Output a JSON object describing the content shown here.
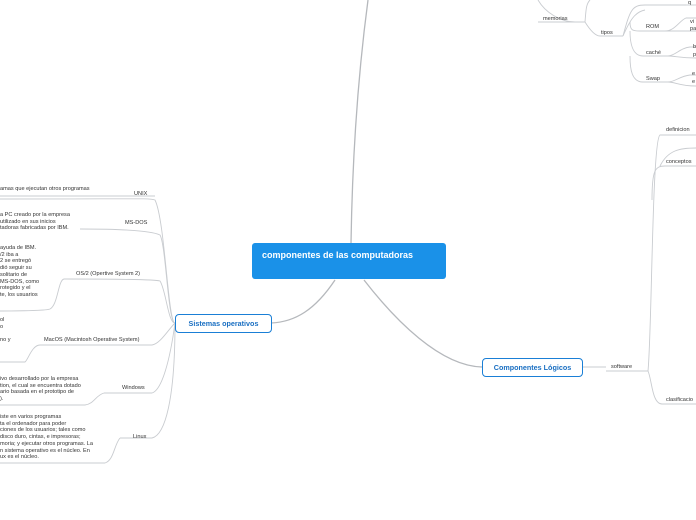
{
  "central": {
    "title": "componentes de las computadoras"
  },
  "main_topics": {
    "sistemas_operativos": "Sistemas operativos",
    "componentes_logicos": "Componentes Lógicos"
  },
  "top_branch": {
    "memorias": "memorias",
    "tipos": "tipos",
    "rom": "ROM",
    "cache": "caché",
    "swap": "Swap",
    "note_top": "q",
    "note_rom": [
      "vi",
      "pa"
    ],
    "note_cache": [
      "b",
      "p"
    ],
    "note_swap": [
      "e",
      "e"
    ]
  },
  "logicos_branch": {
    "software": "software",
    "definicion": "definicion",
    "conceptos": "conceptos",
    "clasificacion": "clasificacio"
  },
  "os_branches": {
    "unix": "UNIX",
    "msdos": "MS-DOS",
    "os2": "OS/2 (Opertive System 2)",
    "macos": "MacOS (Macintosh Operative System)",
    "windows": "Windows",
    "linux": "Linux"
  },
  "os_notes": {
    "unix": [
      "amas que ejecutan otros programas"
    ],
    "msdos": [
      "a PC creado por la empresa",
      "utilizado en sus inicios",
      "tadoras fabricadas por IBM."
    ],
    "os2": [
      "ayuda de IBM.",
      "/2 iba a",
      "2 se entregó",
      "dió seguir su",
      "solitario de",
      "MS-DOS, como",
      "rotegido y el",
      "te, los usuarios"
    ],
    "macos": [
      "ol",
      "o",
      "",
      "no y"
    ],
    "windows": [
      "ivo desarrollado por la empresa",
      "tion, el cual se encuentra dotado",
      "ario basada en el prototipo de",
      ")."
    ],
    "linux": [
      "iste en varios programas",
      "ta el ordenador para poder",
      "ciones de los usuarios; tales como",
      "disco duro, cintas, e impresoras;",
      "moria; y ejecutar otros programas. La",
      "n sistema operativo es el núcleo. En",
      "ux es el núcleo."
    ]
  },
  "colors": {
    "central_bg": "#1a91e8",
    "central_text": "#ffffff",
    "topic_border": "#1a7fd6",
    "topic_text": "#1a6fc2",
    "line": "#c9ccd0",
    "trunk": "#b5b8bc",
    "text": "#333333"
  }
}
